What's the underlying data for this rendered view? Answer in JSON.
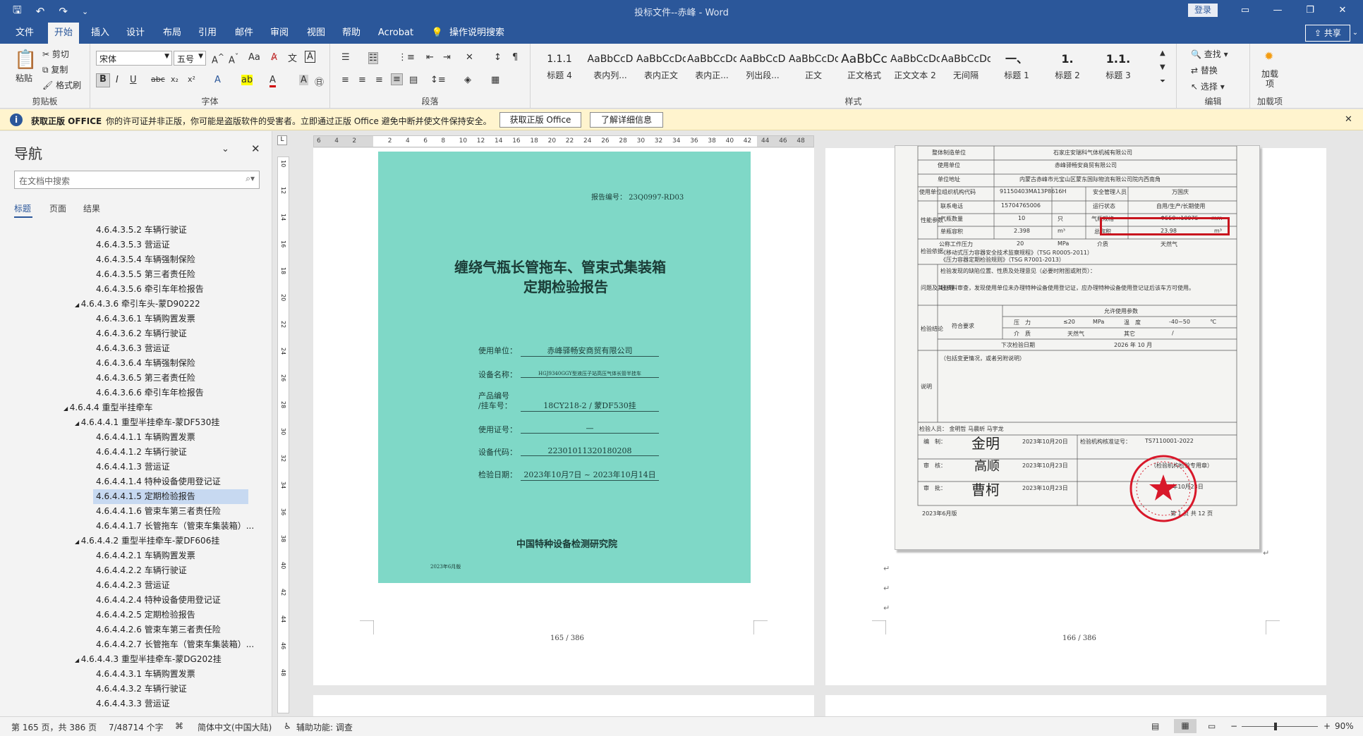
{
  "window": {
    "title": "投标文件--赤峰 - Word",
    "login": "登录",
    "share": "共享",
    "qat_icons": [
      "save-icon",
      "undo-icon",
      "redo-icon",
      "customize-icon"
    ]
  },
  "menu": {
    "tabs": [
      "文件",
      "开始",
      "插入",
      "设计",
      "布局",
      "引用",
      "邮件",
      "审阅",
      "视图",
      "帮助",
      "Acrobat"
    ],
    "active": "开始",
    "tell_me": "操作说明搜索"
  },
  "ribbon": {
    "clipboard": {
      "paste": "粘贴",
      "cut": "剪切",
      "copy": "复制",
      "format_painter": "格式刷",
      "label": "剪贴板"
    },
    "font": {
      "name": "宋体",
      "size": "五号",
      "label": "字体"
    },
    "paragraph": {
      "label": "段落"
    },
    "styles": {
      "label": "样式",
      "items": [
        {
          "preview": "1.1.1",
          "name": "标题 4"
        },
        {
          "preview": "AaBbCcD",
          "name": "表内列..."
        },
        {
          "preview": "AaBbCcDd",
          "name": "表内正文"
        },
        {
          "preview": "AaBbCcDd",
          "name": "表内正..."
        },
        {
          "preview": "AaBbCcD",
          "name": "列出段..."
        },
        {
          "preview": "AaBbCcDd",
          "name": "正文"
        },
        {
          "preview": "AaBbCc",
          "name": "正文格式"
        },
        {
          "preview": "AaBbCcDd",
          "name": "正文文本 2"
        },
        {
          "preview": "AaBbCcDd",
          "name": "无间隔"
        },
        {
          "preview": "一、",
          "name": "标题 1"
        },
        {
          "preview": "1.",
          "name": "标题 2"
        },
        {
          "preview": "1.1.",
          "name": "标题 3"
        }
      ]
    },
    "editing": {
      "find": "查找",
      "replace": "替换",
      "select": "选择",
      "label": "编辑"
    },
    "addins": {
      "button": "加载项",
      "label": "加载项"
    }
  },
  "warning": {
    "title": "获取正版 OFFICE",
    "text": "你的许可证并非正版，你可能是盗版软件的受害者。立即通过正版 Office 避免中断并使文件保持安全。",
    "btn_get": "获取正版 Office",
    "btn_learn": "了解详细信息"
  },
  "nav": {
    "title": "导航",
    "search_placeholder": "在文档中搜索",
    "tabs": [
      "标题",
      "页面",
      "结果"
    ],
    "items": [
      {
        "text": "4.6.4.3.5.2 车辆行驶证",
        "level": 3
      },
      {
        "text": "4.6.4.3.5.3 营运证",
        "level": 3
      },
      {
        "text": "4.6.4.3.5.4 车辆强制保险",
        "level": 3
      },
      {
        "text": "4.6.4.3.5.5 第三者责任险",
        "level": 3
      },
      {
        "text": "4.6.4.3.5.6 牵引车年检报告",
        "level": 3
      },
      {
        "text": "4.6.4.3.6  牵引车头-蒙D90222",
        "level": 2
      },
      {
        "text": "4.6.4.3.6.1 车辆购置发票",
        "level": 3
      },
      {
        "text": "4.6.4.3.6.2 车辆行驶证",
        "level": 3
      },
      {
        "text": "4.6.4.3.6.3 营运证",
        "level": 3
      },
      {
        "text": "4.6.4.3.6.4 车辆强制保险",
        "level": 3
      },
      {
        "text": "4.6.4.3.6.5 第三者责任险",
        "level": 3
      },
      {
        "text": "4.6.4.3.6.6 牵引车年检报告",
        "level": 3
      },
      {
        "text": "4.6.4.4  重型半挂牵车",
        "level": 1
      },
      {
        "text": "4.6.4.4.1  重型半挂牵车-蒙DF530挂",
        "level": 2
      },
      {
        "text": "4.6.4.4.1.1 车辆购置发票",
        "level": 3
      },
      {
        "text": "4.6.4.4.1.2 车辆行驶证",
        "level": 3
      },
      {
        "text": "4.6.4.4.1.3 营运证",
        "level": 3
      },
      {
        "text": "4.6.4.4.1.4 特种设备使用登记证",
        "level": 3
      },
      {
        "text": "4.6.4.4.1.5 定期检验报告",
        "level": 3
      },
      {
        "text": "4.6.4.4.1.6 管束车第三者责任险",
        "level": 3
      },
      {
        "text": "4.6.4.4.1.7 长管拖车（管束车集装箱）...",
        "level": 3
      },
      {
        "text": "4.6.4.4.2  重型半挂牵车-蒙DF606挂",
        "level": 2
      },
      {
        "text": "4.6.4.4.2.1 车辆购置发票",
        "level": 3
      },
      {
        "text": "4.6.4.4.2.2 车辆行驶证",
        "level": 3
      },
      {
        "text": "4.6.4.4.2.3 营运证",
        "level": 3
      },
      {
        "text": "4.6.4.4.2.4 特种设备使用登记证",
        "level": 3
      },
      {
        "text": "4.6.4.4.2.5 定期检验报告",
        "level": 3
      },
      {
        "text": "4.6.4.4.2.6 管束车第三者责任险",
        "level": 3
      },
      {
        "text": "4.6.4.4.2.7 长管拖车（管束车集装箱）...",
        "level": 3
      },
      {
        "text": "4.6.4.4.3  重型半挂牵车-蒙DG202挂",
        "level": 2
      },
      {
        "text": "4.6.4.4.3.1 车辆购置发票",
        "level": 3
      },
      {
        "text": "4.6.4.4.3.2 车辆行驶证",
        "level": 3
      },
      {
        "text": "4.6.4.4.3.3 营运证",
        "level": 3
      }
    ],
    "selected_index": 18
  },
  "ruler": {
    "h_labels": [
      "6",
      "4",
      "2",
      "",
      "2",
      "4",
      "6",
      "8",
      "10",
      "12",
      "14",
      "16",
      "18",
      "20",
      "22",
      "24",
      "26",
      "28",
      "30",
      "32",
      "34",
      "36",
      "38",
      "40",
      "42",
      "44",
      "46",
      "48"
    ],
    "v_labels": [
      "10",
      "12",
      "14",
      "16",
      "18",
      "20",
      "22",
      "24",
      "26",
      "28",
      "30",
      "32",
      "34",
      "36",
      "38",
      "40",
      "42",
      "44",
      "46",
      "48"
    ]
  },
  "page1": {
    "report_no": "报告编号： 23Q0997-RD03",
    "title1": "缠绕气瓶长管拖车、管束式集装箱",
    "title2": "定期检验报告",
    "fields": [
      {
        "label": "使用单位：",
        "value": "赤峰驿畅安商贸有限公司"
      },
      {
        "label": "设备名称：",
        "value": "HGJ9340GGY型液压子站高压气体长管半挂车"
      },
      {
        "label": "产品编号",
        "value": ""
      },
      {
        "label": "/挂车号：",
        "value": "18CY218-2     /     蒙DF530挂"
      },
      {
        "label": "使用证号：",
        "value": "—"
      },
      {
        "label": "设备代码：",
        "value": "22301011320180208"
      },
      {
        "label": "检验日期：",
        "value": "2023年10月7日  ~  2023年10月14日"
      }
    ],
    "institute": "中国特种设备检测研究院",
    "edition": "2023年6月版",
    "page_num": "165 / 386"
  },
  "page2": {
    "rows": [
      {
        "label": "整体制造单位",
        "value": "石家庄安瑞科气体机械有限公司"
      },
      {
        "label": "使用单位",
        "value": "赤峰驿畅安商贸有限公司"
      },
      {
        "label": "单位地址",
        "value": "内蒙古赤峰市元宝山区蒙东国际物流有限公司院内西南角"
      }
    ],
    "org_code_label": "使用单位组织机构代码",
    "org_code": "91150403MA13P8616H",
    "safety_mgr_label": "安全管理人员",
    "safety_mgr": "万国庆",
    "phone_label": "联系电话",
    "phone": "15704765006",
    "status_label": "运行状态",
    "status": "自用/生产/长期使用",
    "param_label": "性能参数",
    "bottle_count_label": "气瓶数量",
    "bottle_count": "10",
    "bottle_count_unit": "只",
    "bottle_spec_label": "气瓶规格",
    "bottle_spec": "Φ559×10975",
    "bottle_spec_unit": "mm",
    "unit_vol_label": "单瓶容积",
    "unit_vol": "2.398",
    "unit_vol_unit": "m³",
    "total_vol_label": "总容积",
    "total_vol": "23.98",
    "total_vol_unit": "m³",
    "pressure_label": "公称工作压力",
    "pressure": "20",
    "pressure_unit": "MPa",
    "medium_label": "介质",
    "medium": "天然气",
    "basis_label": "检验依据",
    "basis1": "《移动式压力容器安全技术监察规程》（TSG R0005-2011）",
    "basis2": "《压力容器定期检验规则》（TSG R7001-2013）",
    "issue_label": "问题及其处理",
    "issue_head": "检验发现的缺陷位置、性质及处理意见（必要时附图或附页）：",
    "issue_text": "经资料审查，发现使用单位未办理特种设备使用登记证，应办理特种设备使用登记证后该车方可使用。",
    "conclusion_label": "检验结论",
    "allowed_label": "允许使用参数",
    "conform": "符合要求",
    "pressure_k": "压　力",
    "pressure_v": "≤20",
    "pressure_u": "MPa",
    "temp_k": "温　度",
    "temp_v": "-40~50",
    "temp_u": "℃",
    "medium_k": "介　质",
    "medium_v": "天然气",
    "other_k": "其它",
    "other_v": "/",
    "next_date_label": "下次检验日期",
    "next_date": "2026 年 10 月",
    "note_label": "说明",
    "note_text": "（包括变更情况，或者另附说明）",
    "inspectors": "检验人员：  金明哲  马晨昕  马宇龙",
    "compile_label": "编　制：",
    "compile_date": "2023年10月20日",
    "review_label": "审　核：",
    "review_date": "2023年10月23日",
    "approve_label": "审　批：",
    "approve_date": "2023年10月23日",
    "institute_code_label": "检验机构核准证号：",
    "institute_code": "TS7110001-2022",
    "seal_label": "（检验机构检验专用章）",
    "seal_date": "2023年10月23日",
    "edition": "2023年6月版",
    "page_of": "第 1 页  共 12 页",
    "page_num": "166 / 386"
  },
  "status": {
    "page": "第 165 页，共 386 页",
    "words": "7/48714 个字",
    "lang": "简体中文(中国大陆)",
    "accessibility": "辅助功能: 调查",
    "zoom": "90%",
    "zoom_level": 0.9
  }
}
